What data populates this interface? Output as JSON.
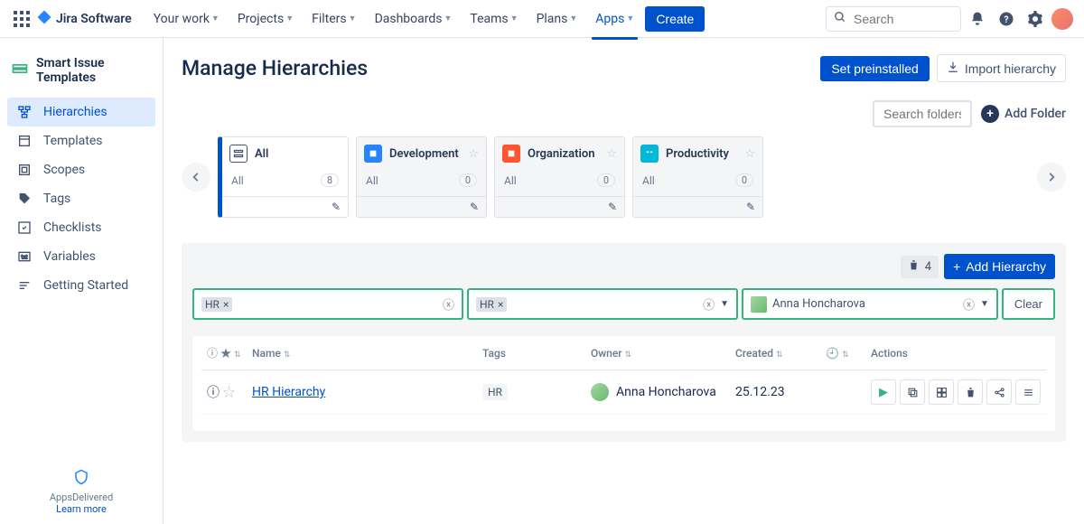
{
  "nav": {
    "brand": "Jira Software",
    "items": [
      "Your work",
      "Projects",
      "Filters",
      "Dashboards",
      "Teams",
      "Plans",
      "Apps"
    ],
    "activeIndex": 6,
    "create": "Create",
    "searchPlaceholder": "Search"
  },
  "sidebar": {
    "title": "Smart Issue Templates",
    "items": [
      {
        "label": "Hierarchies",
        "icon": "hierarchy"
      },
      {
        "label": "Templates",
        "icon": "template"
      },
      {
        "label": "Scopes",
        "icon": "scope"
      },
      {
        "label": "Tags",
        "icon": "tag"
      },
      {
        "label": "Checklists",
        "icon": "checklist"
      },
      {
        "label": "Variables",
        "icon": "variable"
      },
      {
        "label": "Getting Started",
        "icon": "list"
      }
    ],
    "activeIndex": 0,
    "footer": {
      "brand": "AppsDelivered",
      "link": "Learn more"
    }
  },
  "page": {
    "title": "Manage Hierarchies",
    "setPreinstalled": "Set preinstalled",
    "importHierarchy": "Import hierarchy",
    "folderSearchPlaceholder": "Search folders...",
    "addFolder": "Add Folder"
  },
  "folders": [
    {
      "name": "All",
      "count": "8",
      "subLabel": "All",
      "iconClass": "all",
      "active": true
    },
    {
      "name": "Development",
      "count": "0",
      "subLabel": "All",
      "iconClass": "blue",
      "active": false
    },
    {
      "name": "Organization",
      "count": "0",
      "subLabel": "All",
      "iconClass": "red",
      "active": false
    },
    {
      "name": "Productivity",
      "count": "0",
      "subLabel": "All",
      "iconClass": "teal",
      "active": false
    }
  ],
  "panel": {
    "count": "4",
    "addHierarchy": "Add Hierarchy",
    "filter1": "HR",
    "filter2": "HR",
    "owner": "Anna Honcharova",
    "clear": "Clear"
  },
  "table": {
    "headers": {
      "name": "Name",
      "tags": "Tags",
      "owner": "Owner",
      "created": "Created",
      "actions": "Actions"
    },
    "rows": [
      {
        "name": "HR Hierarchy",
        "tag": "HR",
        "owner": "Anna Honcharova",
        "created": "25.12.23"
      }
    ]
  }
}
